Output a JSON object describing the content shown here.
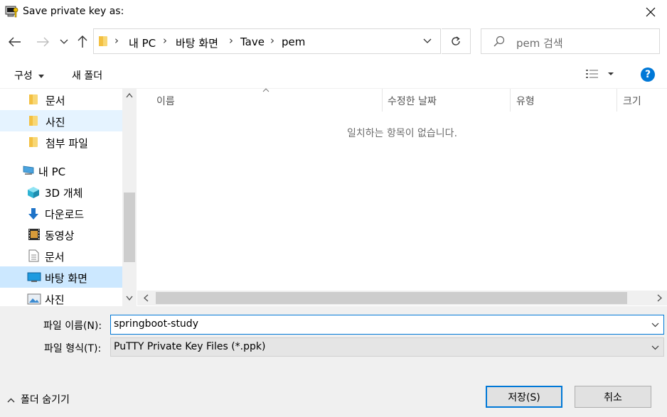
{
  "window": {
    "title": "Save private key as:"
  },
  "address_bar": {
    "crumbs": [
      "내 PC",
      "바탕 화면",
      "Tave",
      "pem"
    ]
  },
  "search": {
    "placeholder": "pem 검색"
  },
  "toolbar": {
    "organize_label": "구성",
    "new_folder_label": "새 폴더"
  },
  "sidebar": {
    "items": [
      {
        "label": "문서",
        "icon": "folder-icon"
      },
      {
        "label": "사진",
        "icon": "folder-icon"
      },
      {
        "label": "첨부 파일",
        "icon": "folder-icon"
      },
      {
        "label": "내 PC",
        "icon": "computer-icon"
      },
      {
        "label": "3D 개체",
        "icon": "cube-icon"
      },
      {
        "label": "다운로드",
        "icon": "download-icon"
      },
      {
        "label": "동영상",
        "icon": "video-icon"
      },
      {
        "label": "문서",
        "icon": "document-icon"
      },
      {
        "label": "바탕 화면",
        "icon": "desktop-icon"
      },
      {
        "label": "사진",
        "icon": "pictures-icon"
      }
    ]
  },
  "file_list": {
    "columns": [
      "이름",
      "수정한 날짜",
      "유형",
      "크기"
    ],
    "empty_message": "일치하는 항목이 없습니다."
  },
  "form": {
    "filename_label": "파일 이름(N):",
    "filename_value": "springboot-study",
    "filetype_label": "파일 형식(T):",
    "filetype_value": "PuTTY Private Key Files (*.ppk)"
  },
  "footer": {
    "hide_folders_label": "폴더 숨기기",
    "save_label": "저장(S)",
    "cancel_label": "취소"
  },
  "colors": {
    "accent": "#0078d7",
    "selected_bg": "#cce8ff",
    "hover_bg": "#e5f3ff"
  }
}
